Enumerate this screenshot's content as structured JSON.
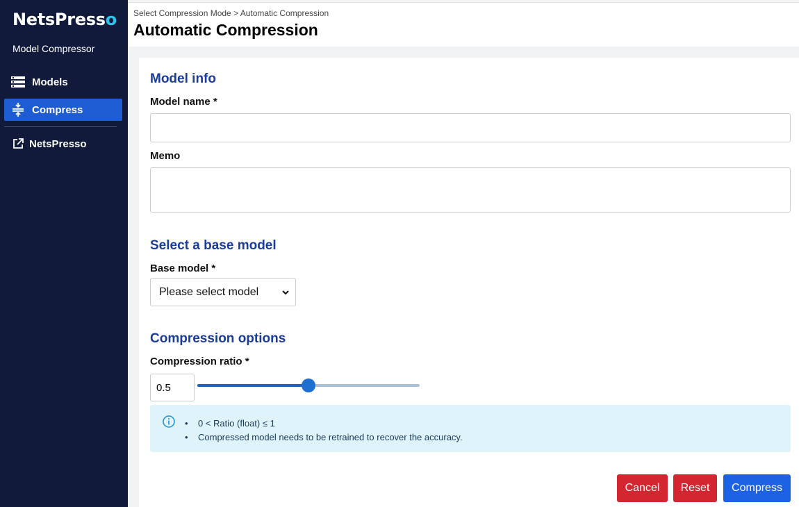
{
  "sidebar": {
    "brand_main": "NetsPress",
    "brand_o": "o",
    "subtitle": "Model Compressor",
    "items": [
      {
        "label": "Models",
        "icon": "list-icon"
      },
      {
        "label": "Compress",
        "icon": "compress-icon",
        "active": true
      },
      {
        "label": "NetsPresso",
        "icon": "external-link-icon"
      }
    ]
  },
  "header": {
    "breadcrumb": "Select Compression Mode > Automatic Compression",
    "title": "Automatic Compression"
  },
  "model_info": {
    "title": "Model info",
    "name_label": "Model name *",
    "name_value": "",
    "memo_label": "Memo",
    "memo_value": ""
  },
  "base_model": {
    "title": "Select a base model",
    "label": "Base model *",
    "selected": "Please select model"
  },
  "compression": {
    "title": "Compression options",
    "ratio_label": "Compression ratio *",
    "ratio_value": "0.5",
    "ratio_fraction": 0.5,
    "info": [
      "0 < Ratio (float) ≤ 1",
      "Compressed model needs to be retrained to recover the accuracy."
    ]
  },
  "actions": {
    "cancel": "Cancel",
    "reset": "Reset",
    "compress": "Compress"
  },
  "colors": {
    "sidebar_bg": "#111a3a",
    "accent": "#1d5cd3",
    "section_title": "#1a3c9a",
    "danger": "#d42630",
    "info_bg": "#dff3fa"
  }
}
